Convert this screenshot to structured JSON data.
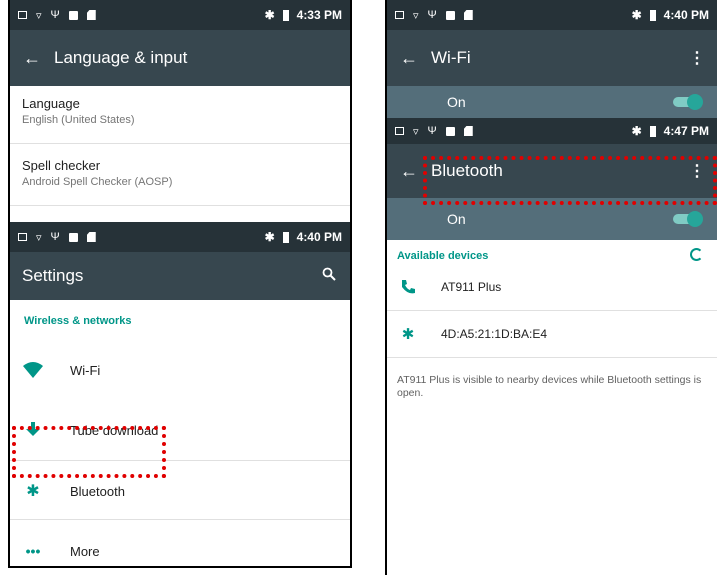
{
  "left_phone": {
    "status_top": {
      "time": "4:33 PM"
    },
    "language_screen": {
      "title": "Language & input",
      "items": [
        {
          "label": "Language",
          "value": "English (United States)"
        },
        {
          "label": "Spell checker",
          "value": "Android Spell Checker (AOSP)"
        }
      ]
    },
    "status_settings": {
      "time": "4:40 PM"
    },
    "settings_screen": {
      "title": "Settings",
      "section": "Wireless & networks",
      "items": [
        {
          "label": "Wi-Fi",
          "icon": "wifi-icon"
        },
        {
          "label": "Tube download",
          "icon": "download-icon"
        },
        {
          "label": "Bluetooth",
          "icon": "bluetooth-icon"
        },
        {
          "label": "More",
          "icon": "more-dots-icon"
        }
      ]
    }
  },
  "right_phone": {
    "status_wifi": {
      "time": "4:40 PM"
    },
    "wifi_screen": {
      "title": "Wi-Fi",
      "switch_label": "On"
    },
    "status_bt": {
      "time": "4:47 PM"
    },
    "bluetooth_screen": {
      "title": "Bluetooth",
      "switch_label": "On",
      "section": "Available devices",
      "devices": [
        {
          "name": "AT911 Plus",
          "icon": "phone-icon"
        },
        {
          "name": "4D:A5:21:1D:BA:E4",
          "icon": "bluetooth-icon"
        }
      ],
      "note": "AT911 Plus is visible to nearby devices while Bluetooth settings is open."
    }
  },
  "colors": {
    "statusbar": "#263238",
    "toolbar": "#37474f",
    "switch_row": "#546e7a",
    "accent": "#009688",
    "highlight": "#e00000"
  }
}
